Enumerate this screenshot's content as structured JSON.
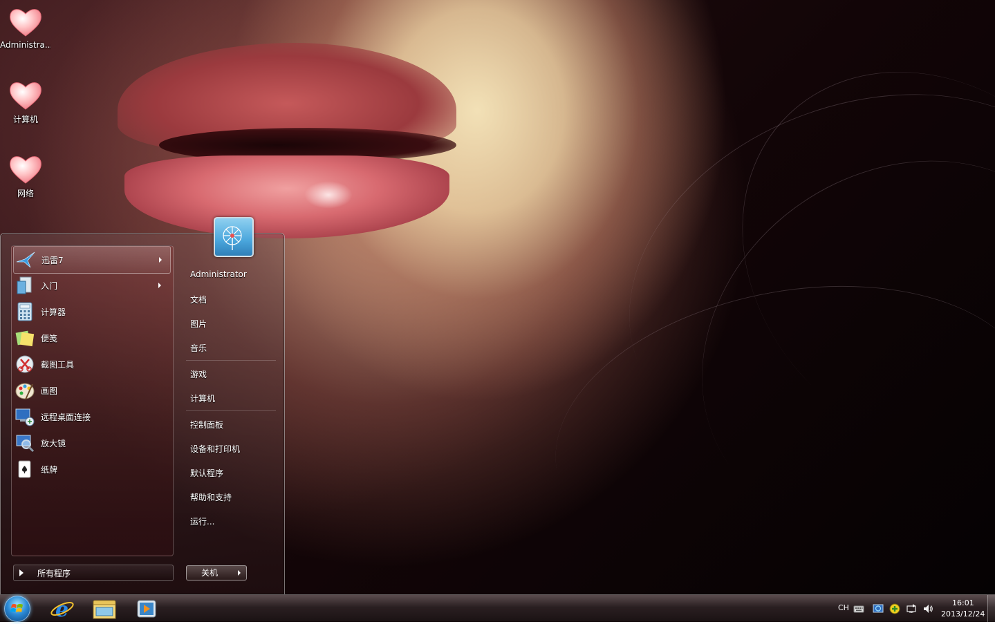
{
  "desktop": {
    "icons": [
      {
        "label": "Administra..."
      },
      {
        "label": "计算机"
      },
      {
        "label": "网络"
      }
    ]
  },
  "start_menu": {
    "programs": [
      {
        "label": "迅雷7",
        "icon": "thunder-bird-icon",
        "has_submenu": true
      },
      {
        "label": "入门",
        "icon": "getting-started-icon",
        "has_submenu": true
      },
      {
        "label": "计算器",
        "icon": "calculator-icon",
        "has_submenu": false
      },
      {
        "label": "便笺",
        "icon": "sticky-notes-icon",
        "has_submenu": false
      },
      {
        "label": "截图工具",
        "icon": "snipping-tool-icon",
        "has_submenu": false
      },
      {
        "label": "画图",
        "icon": "paint-palette-icon",
        "has_submenu": false
      },
      {
        "label": "远程桌面连接",
        "icon": "remote-desktop-icon",
        "has_submenu": false
      },
      {
        "label": "放大镜",
        "icon": "magnifier-icon",
        "has_submenu": false
      },
      {
        "label": "纸牌",
        "icon": "solitaire-cards-icon",
        "has_submenu": false
      }
    ],
    "all_programs": "所有程序",
    "user_name": "Administrator",
    "right_items": {
      "documents": "文档",
      "pictures": "图片",
      "music": "音乐",
      "games": "游戏",
      "computer": "计算机",
      "control_panel": "控制面板",
      "devices_printers": "设备和打印机",
      "default_programs": "默认程序",
      "help_support": "帮助和支持",
      "run": "运行..."
    },
    "shutdown": "关机"
  },
  "taskbar": {
    "pinned": [
      {
        "name": "ie-icon"
      },
      {
        "name": "explorer-folder-icon"
      },
      {
        "name": "media-player-icon"
      }
    ],
    "tray": {
      "language": "CH",
      "time": "16:01",
      "date": "2013/12/24"
    }
  },
  "colors": {
    "taskbar": "#2a1f21",
    "orb": "#2b8ad6"
  }
}
